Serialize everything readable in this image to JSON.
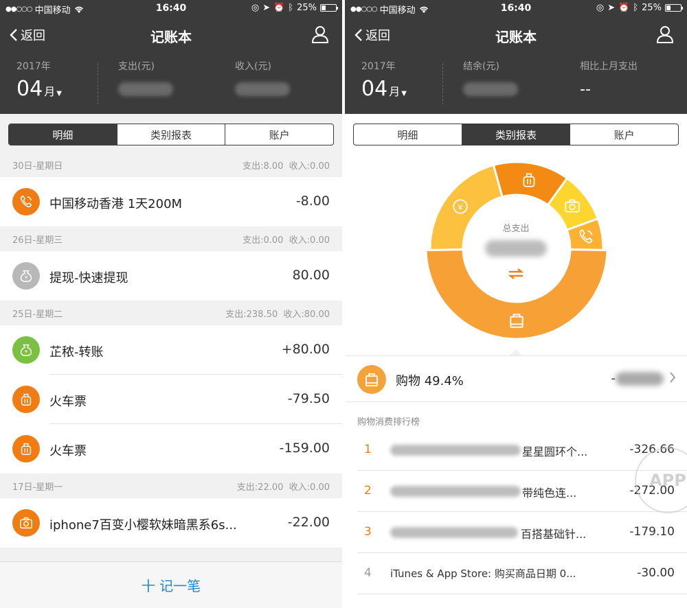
{
  "colors": {
    "header_bg": "#3b3b3b",
    "accent_blue": "#1e88d4",
    "orange": "#f07d14",
    "gray_icon": "#b8b8b8",
    "green_icon": "#7bc043"
  },
  "status": {
    "carrier": "中国移动",
    "time": "16:40",
    "battery": "25%"
  },
  "left": {
    "nav": {
      "back_label": "返回",
      "title": "记账本"
    },
    "summary": {
      "year": "2017年",
      "month": "04",
      "month_unit": "月",
      "col2_label": "支出(元)",
      "col3_label": "收入(元)"
    },
    "tabs": [
      {
        "label": "明细",
        "active": true
      },
      {
        "label": "类别报表",
        "active": false
      },
      {
        "label": "账户",
        "active": false
      }
    ],
    "days": [
      {
        "date": "30日-星期日",
        "spend": "支出:8.00",
        "income": "收入:0.00",
        "items": [
          {
            "icon": "phone-icon",
            "name": "中国移动香港 1天200M",
            "amount": "-8.00",
            "color": "#f07d14"
          }
        ]
      },
      {
        "date": "26日-星期三",
        "spend": "支出:0.00",
        "income": "收入:0.00",
        "items": [
          {
            "icon": "money-bag-icon",
            "name": "提现-快速提现",
            "amount": "80.00",
            "color": "#b8b8b8"
          }
        ]
      },
      {
        "date": "25日-星期二",
        "spend": "支出:238.50",
        "income": "收入:80.00",
        "items": [
          {
            "icon": "money-bag-icon",
            "name": "芷秾-转账",
            "amount": "+80.00",
            "color": "#7bc043"
          },
          {
            "icon": "luggage-icon",
            "name": "火车票",
            "amount": "-79.50",
            "color": "#f07d14"
          },
          {
            "icon": "luggage-icon",
            "name": "火车票",
            "amount": "-159.00",
            "color": "#f07d14"
          }
        ]
      },
      {
        "date": "17日-星期一",
        "spend": "支出:22.00",
        "income": "收入:0.00",
        "items": [
          {
            "icon": "camera-icon",
            "name": "iphone7百变小樱软妹暗黑系6s...",
            "amount": "-22.00",
            "color": "#f07d14"
          }
        ]
      }
    ],
    "add_button": "十 记一笔"
  },
  "right": {
    "nav": {
      "back_label": "返回",
      "title": "记账本"
    },
    "summary": {
      "year": "2017年",
      "month": "04",
      "month_unit": "月",
      "col2_label": "结余(元)",
      "col3_label": "相比上月支出",
      "col3_value": "--"
    },
    "tabs": [
      {
        "label": "明细",
        "active": false
      },
      {
        "label": "类别报表",
        "active": true
      },
      {
        "label": "账户",
        "active": false
      }
    ],
    "donut": {
      "center_label": "总支出",
      "segments": [
        {
          "icon": "shopping-bag-icon",
          "share": 49.4,
          "color": "#f7a035"
        },
        {
          "icon": "yen-icon",
          "share": 21.0,
          "color": "#fcc13e"
        },
        {
          "icon": "luggage-icon",
          "share": 14.2,
          "color": "#f38a14"
        },
        {
          "icon": "camera-icon",
          "share": 9.5,
          "color": "#fdd52f"
        },
        {
          "icon": "phone-icon",
          "share": 5.9,
          "color": "#fbb131"
        }
      ]
    },
    "selected": {
      "name": "购物 49.4%",
      "amount_prefix": "-"
    },
    "rank_title": "购物消费排行榜",
    "rank": [
      {
        "no": "1",
        "name": "星星圆环个...",
        "amount": "-326.66",
        "highlight": true
      },
      {
        "no": "2",
        "name": "带纯色连...",
        "amount": "-272.00",
        "highlight": true
      },
      {
        "no": "3",
        "name": "百搭基础针...",
        "amount": "-179.10",
        "highlight": true
      },
      {
        "no": "4",
        "name": "iTunes & App Store: 购买商品日期 0...",
        "amount": "-30.00",
        "highlight": false
      }
    ],
    "watermark": "APP"
  }
}
